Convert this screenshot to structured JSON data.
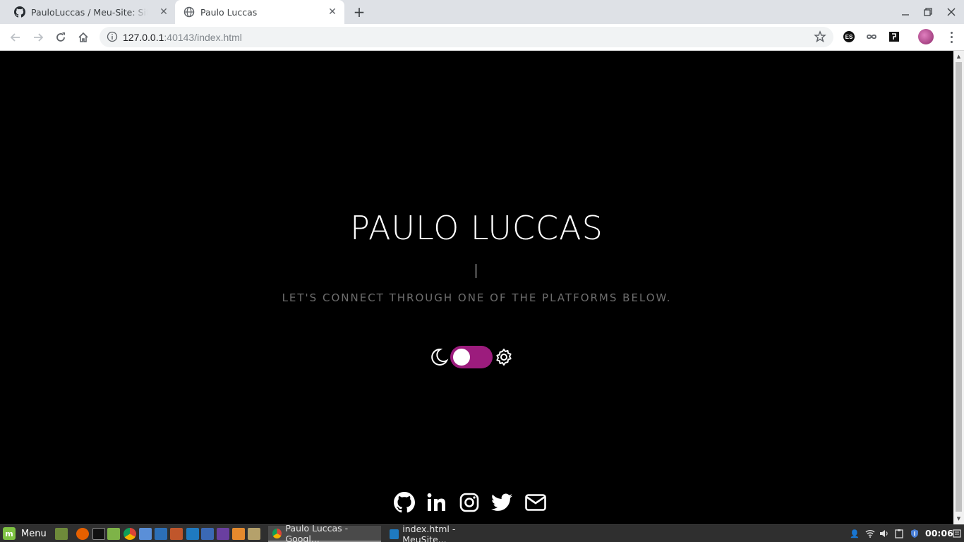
{
  "browser": {
    "tabs": [
      {
        "title": "PauloLuccas / Meu-Site: Site ca",
        "favicon": "github-icon",
        "active": false
      },
      {
        "title": "Paulo Luccas",
        "favicon": "globe-icon",
        "active": true
      }
    ],
    "address": {
      "host": "127.0.0.1",
      "rest": ":40143/index.html"
    },
    "extension_es_label": "ES"
  },
  "page": {
    "name": "PAULO LUCCAS",
    "tagline": "LET'S CONNECT THROUGH ONE OF THE PLATFORMS BELOW.",
    "theme_switch": {
      "state": "on",
      "accent": "#9c1c7d",
      "left_icon": "moon-icon",
      "right_icon": "gear-icon"
    },
    "socials": [
      "github-icon",
      "linkedin-icon",
      "instagram-icon",
      "twitter-icon",
      "envelope-icon"
    ]
  },
  "taskbar": {
    "menu_label": "Menu",
    "tasks": [
      {
        "label": "Paulo Luccas - Googl...",
        "icon": "chrome-icon"
      },
      {
        "label": "index.html - MeuSite...",
        "icon": "vscode-icon"
      }
    ],
    "clock": "00:06"
  }
}
